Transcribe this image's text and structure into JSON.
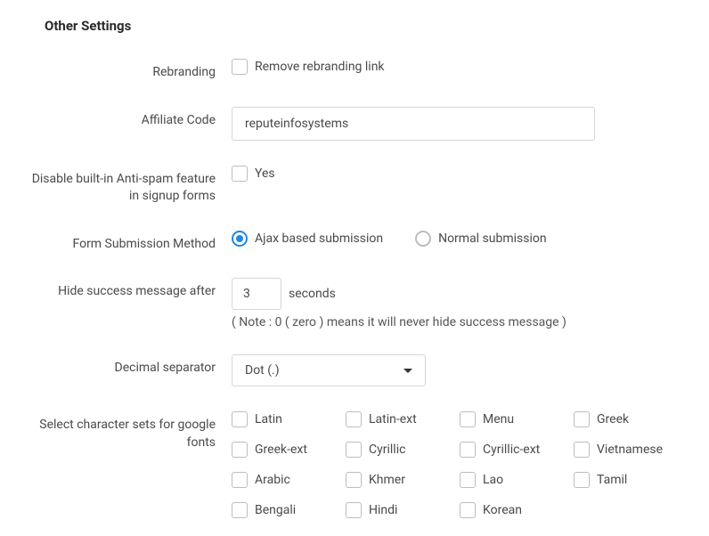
{
  "section_title": "Other Settings",
  "rebranding": {
    "label": "Rebranding",
    "checkbox_label": "Remove rebranding link",
    "checked": false
  },
  "affiliate": {
    "label": "Affiliate Code",
    "value": "reputeinfosystems"
  },
  "antispam": {
    "label": "Disable built-in Anti-spam feature in signup forms",
    "checkbox_label": "Yes",
    "checked": false
  },
  "submission": {
    "label": "Form Submission Method",
    "options": {
      "ajax": "Ajax based submission",
      "normal": "Normal submission"
    },
    "selected": "ajax"
  },
  "hide_success": {
    "label": "Hide success message after",
    "value": "3",
    "unit": "seconds",
    "note": "( Note : 0 ( zero ) means it will never hide success message )"
  },
  "decimal": {
    "label": "Decimal separator",
    "selected": "Dot (.)"
  },
  "charsets": {
    "label": "Select character sets for google fonts",
    "items": [
      "Latin",
      "Latin-ext",
      "Menu",
      "Greek",
      "Greek-ext",
      "Cyrillic",
      "Cyrillic-ext",
      "Vietnamese",
      "Arabic",
      "Khmer",
      "Lao",
      "Tamil",
      "Bengali",
      "Hindi",
      "Korean"
    ]
  }
}
